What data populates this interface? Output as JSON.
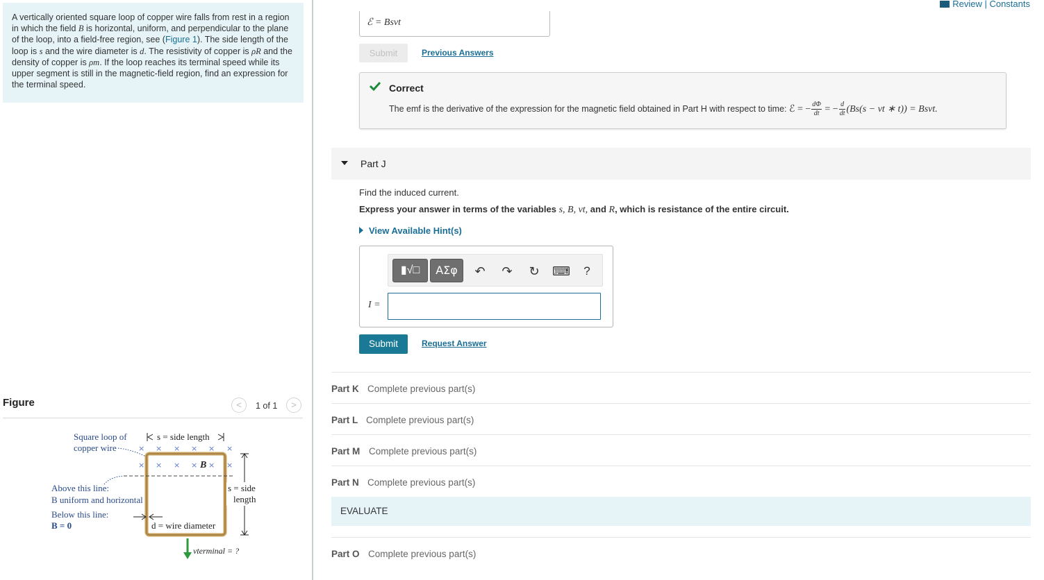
{
  "header": {
    "review_constants": "Review | Constants"
  },
  "problem": {
    "t1": "A vertically oriented square loop of copper wire falls from rest in a region in which the field ",
    "B": "B",
    "t2": " is horizontal, uniform, and perpendicular to the plane of the loop, into a field-free region, see (",
    "figure_link": "Figure 1",
    "t3": "). The side length of the loop is ",
    "s": "s",
    "t4": " and the wire diameter is ",
    "d": "d",
    "t5": ". The resistivity of copper is ",
    "rhoR": "ρR",
    "t6": " and the density of copper is ",
    "rhom": "ρm",
    "t7": ". If the loop reaches its terminal speed while its upper segment is still in the magnetic-field region, find an expression for the terminal speed."
  },
  "figure": {
    "title": "Figure",
    "page": "1 of 1",
    "prev": "<",
    "next": ">",
    "label_loop1": "Square loop of",
    "label_loop2": "copper wire",
    "label_side_top": "s = side length",
    "label_side_right1": "s = side",
    "label_side_right2": "length",
    "label_above1": "Above this line:",
    "label_above2": "B uniform and horizontal",
    "label_below1": "Below this line:",
    "label_below2": "B = 0",
    "label_diam": "d = wire diameter",
    "label_b": "B",
    "label_vt": "vterminal = ?",
    "cross": "×"
  },
  "previous_part": {
    "answer": "ℰ =  Bsvt",
    "submit_label": "Submit",
    "previous_answers": "Previous Answers"
  },
  "feedback": {
    "status": "Correct",
    "text": "The emf is the derivative of the expression for the magnetic field obtained in Part H with respect to time: ",
    "eq_start": "ℰ = −",
    "frac1_num": "dΦ",
    "frac1_den": "dt",
    "eq_mid": " = −",
    "frac2_num": "d",
    "frac2_den": "dt",
    "eq_end": "(Bs(s − vt ∗ t)) = Bsvt."
  },
  "part_j": {
    "title": "Part J",
    "question": "Find the induced current.",
    "express_prefix": "Express your answer in terms of the variables ",
    "vars": "s, B, vt,",
    "express_and": " and ",
    "var_R": "R",
    "express_suffix": ", which is resistance of the entire circuit.",
    "hints": "View Available Hint(s)",
    "variable_label": "I =",
    "input_value": "",
    "templates_icon": "▮√□",
    "symbols_icon": "ΑΣφ",
    "undo_icon": "↶",
    "redo_icon": "↷",
    "reset_icon": "↻",
    "keyboard_icon": "⌨",
    "help_icon": "?",
    "submit_label": "Submit",
    "request_answer": "Request Answer"
  },
  "parts": [
    {
      "label": "Part K",
      "status": "Complete previous part(s)"
    },
    {
      "label": "Part L",
      "status": "Complete previous part(s)"
    },
    {
      "label": "Part M",
      "status": "Complete previous part(s)"
    },
    {
      "label": "Part N",
      "status": "Complete previous part(s)"
    },
    {
      "label": "Part O",
      "status": "Complete previous part(s)"
    }
  ],
  "evaluate": {
    "label": "EVALUATE"
  },
  "colors": {
    "accent": "#1a7a95",
    "link": "#1a6e96",
    "correct_green": "#1b8a3a",
    "panel_blue": "#e6f4f7",
    "loop_gold": "#c9a25f",
    "arrow_green": "#2e9a3e"
  }
}
